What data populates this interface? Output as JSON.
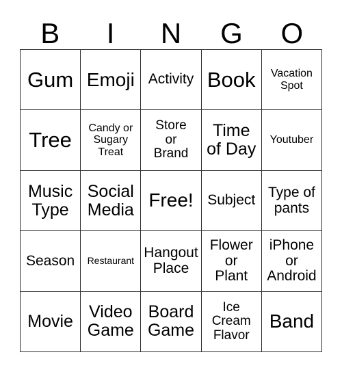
{
  "card": {
    "header_letters": [
      "B",
      "I",
      "N",
      "G",
      "O"
    ],
    "rows": [
      [
        {
          "text": "Gum",
          "size": "fs-xxl"
        },
        {
          "text": "Emoji",
          "size": "fs-xl"
        },
        {
          "text": "Activity",
          "size": "fs-md"
        },
        {
          "text": "Book",
          "size": "fs-xxl"
        },
        {
          "text": "Vacation\nSpot",
          "size": "fs-xs"
        }
      ],
      [
        {
          "text": "Tree",
          "size": "fs-xxl"
        },
        {
          "text": "Candy or\nSugary\nTreat",
          "size": "fs-xs"
        },
        {
          "text": "Store\nor\nBrand",
          "size": "fs-sm"
        },
        {
          "text": "Time\nof Day",
          "size": "fs-lg"
        },
        {
          "text": "Youtuber",
          "size": "fs-xs"
        }
      ],
      [
        {
          "text": "Music\nType",
          "size": "fs-lg"
        },
        {
          "text": "Social\nMedia",
          "size": "fs-lg"
        },
        {
          "text": "Free!",
          "size": "fs-xl"
        },
        {
          "text": "Subject",
          "size": "fs-md"
        },
        {
          "text": "Type of\npants",
          "size": "fs-md"
        }
      ],
      [
        {
          "text": "Season",
          "size": "fs-md"
        },
        {
          "text": "Restaurant",
          "size": "fs-xxs"
        },
        {
          "text": "Hangout\nPlace",
          "size": "fs-md"
        },
        {
          "text": "Flower\nor\nPlant",
          "size": "fs-md"
        },
        {
          "text": "iPhone\nor\nAndroid",
          "size": "fs-md"
        }
      ],
      [
        {
          "text": "Movie",
          "size": "fs-lg"
        },
        {
          "text": "Video\nGame",
          "size": "fs-lg"
        },
        {
          "text": "Board\nGame",
          "size": "fs-lg"
        },
        {
          "text": "Ice\nCream\nFlavor",
          "size": "fs-sm"
        },
        {
          "text": "Band",
          "size": "fs-xl"
        }
      ]
    ]
  },
  "colors": {
    "background": "#ffffff",
    "text": "#000000",
    "grid_line": "#2b2b2b"
  }
}
